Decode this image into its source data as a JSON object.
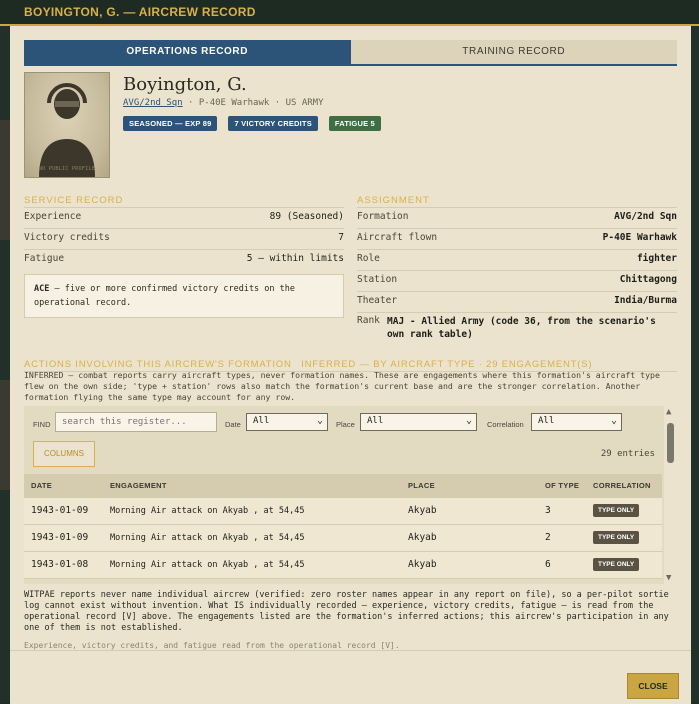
{
  "window": {
    "title": "BOYINGTON, G. — AIRCREW RECORD"
  },
  "tabs": [
    {
      "label": "OPERATIONS RECORD",
      "active": true
    },
    {
      "label": "TRAINING RECORD",
      "active": false
    }
  ],
  "pilot": {
    "name": "Boyington, G.",
    "unit_link": "AVG/2nd Sqn",
    "aircraft": "P-40E Warhawk",
    "service": "US ARMY",
    "portrait_watermark": "NO PUBLIC PROFILE",
    "badges": [
      {
        "label": "SEASONED — EXP 89",
        "color": "#2c5378"
      },
      {
        "label": "7 VICTORY CREDITS",
        "color": "#2c5378"
      },
      {
        "label": "FATIGUE 5",
        "color": "#3f6e43"
      }
    ]
  },
  "service_record": {
    "heading": "SERVICE RECORD",
    "rows": [
      {
        "label": "Experience",
        "value": "89 (Seasoned)"
      },
      {
        "label": "Victory credits",
        "value": "7"
      },
      {
        "label": "Fatigue",
        "value": "5 — within limits"
      }
    ],
    "ace_note": {
      "bold": "ACE",
      "text": " — five or more confirmed victory credits on the operational record."
    }
  },
  "assignment": {
    "heading": "ASSIGNMENT",
    "rows": [
      {
        "label": "Formation",
        "value": "AVG/2nd Sqn"
      },
      {
        "label": "Aircraft flown",
        "value": "P-40E Warhawk"
      },
      {
        "label": "Role",
        "value": "fighter"
      },
      {
        "label": "Station",
        "value": "Chittagong"
      },
      {
        "label": "Theater",
        "value": "India/Burma"
      }
    ],
    "rank": {
      "label": "Rank",
      "value": "MAJ - Allied Army (code 36, from the scenario's own rank table)"
    }
  },
  "actions": {
    "heading": "ACTIONS INVOLVING THIS AIRCREW'S FORMATION",
    "heading_suffix": "INFERRED — BY AIRCRAFT TYPE · 29 ENGAGEMENT(S)",
    "note": "INFERRED — combat reports carry aircraft types, never formation names. These are engagements where this formation's aircraft type flew on the own side; 'type + station' rows also match the formation's current base and are the stronger correlation. Another formation flying the same type may account for any row.",
    "filters": {
      "find_label": "FIND",
      "search_placeholder": "search this register...",
      "date_label": "Date",
      "date_value": "All",
      "place_label": "Place",
      "place_value": "All",
      "correlation_label": "Correlation",
      "correlation_value": "All"
    },
    "columns_button": "COLUMNS",
    "entries": "29 entries",
    "table_headers": [
      "DATE",
      "ENGAGEMENT",
      "PLACE",
      "OF TYPE",
      "CORRELATION"
    ],
    "rows": [
      {
        "date": "1943-01-09",
        "engagement": "Morning Air attack on Akyab , at 54,45",
        "place": "Akyab",
        "of_type": "3",
        "correlation": "TYPE ONLY"
      },
      {
        "date": "1943-01-09",
        "engagement": "Morning Air attack on Akyab , at 54,45",
        "place": "Akyab",
        "of_type": "2",
        "correlation": "TYPE ONLY"
      },
      {
        "date": "1943-01-08",
        "engagement": "Morning Air attack on Akyab , at 54,45",
        "place": "Akyab",
        "of_type": "6",
        "correlation": "TYPE ONLY"
      }
    ]
  },
  "disclaimer": "WITPAE reports never name individual aircrew (verified: zero roster names appear in any report on file), so a per-pilot sortie log cannot exist without invention. What IS individually recorded — experience, victory credits, fatigue — is read from the operational record [V] above. The engagements listed are the formation's inferred actions; this aircrew's participation in any one of them is not established.",
  "source_note": "Experience, victory credits, and fatigue read from the operational record [V].",
  "footer": {
    "close_label": "CLOSE"
  }
}
